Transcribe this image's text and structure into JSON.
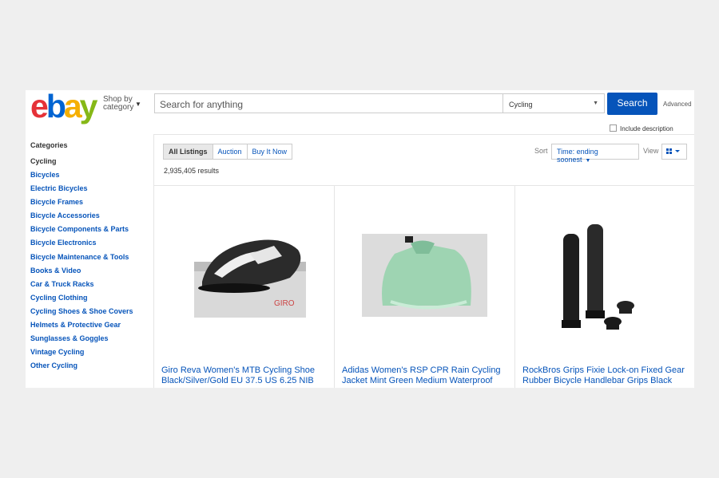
{
  "header": {
    "logo": {
      "e": "e",
      "b": "b",
      "a": "a",
      "y": "y"
    },
    "shop_by_line1": "Shop by",
    "shop_by_line2": "category",
    "search_placeholder": "Search for anything",
    "category_select": "Cycling",
    "search_button": "Search",
    "advanced_link": "Advanced",
    "include_description": "Include description"
  },
  "sidebar": {
    "title": "Categories",
    "current": "Cycling",
    "items": [
      "Bicycles",
      "Electric Bicycles",
      "Bicycle Frames",
      "Bicycle Accessories",
      "Bicycle Components & Parts",
      "Bicycle Electronics",
      "Bicycle Maintenance & Tools",
      "Books & Video",
      "Car & Truck Racks",
      "Cycling Clothing",
      "Cycling Shoes & Shoe Covers",
      "Helmets & Protective Gear",
      "Sunglasses & Goggles",
      "Vintage Cycling",
      "Other Cycling"
    ]
  },
  "toolbar": {
    "tabs": [
      "All Listings",
      "Auction",
      "Buy It Now"
    ],
    "results": "2,935,405 results",
    "sort_label": "Sort",
    "sort_value": "Time: ending soonest",
    "view_label": "View"
  },
  "listings": [
    {
      "title": "Giro Reva Women's MTB Cycling Shoe Black/Silver/Gold EU 37.5 US 6.25 NIB"
    },
    {
      "title": "Adidas Women's RSP CPR Rain Cycling Jacket Mint Green Medium Waterproof"
    },
    {
      "title": "RockBros Grips Fixie Lock-on Fixed Gear Rubber Bicycle Handlebar Grips Black"
    }
  ],
  "colors": {
    "link": "#0654ba",
    "search_button": "#0654ba",
    "page_bg": "#efefef"
  }
}
